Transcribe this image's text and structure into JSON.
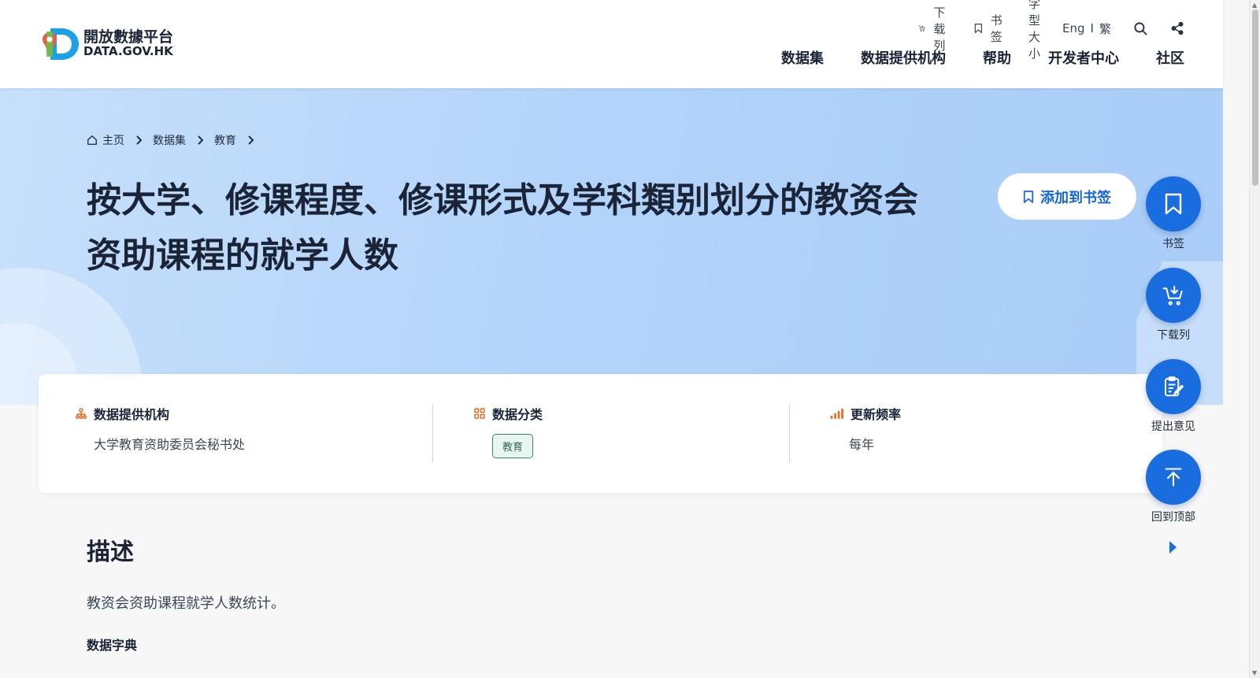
{
  "header": {
    "logo_zh": "開放數據平台",
    "logo_en": "DATA.GOV.HK",
    "util": {
      "download_list": "下载列",
      "bookmark": "书签",
      "font_size": "字型大小",
      "lang_en": "Eng",
      "lang_sep": "I",
      "lang_tc": "繁"
    },
    "nav": [
      "数据集",
      "数据提供机构",
      "帮助",
      "开发者中心",
      "社区"
    ]
  },
  "breadcrumb": [
    "主页",
    "数据集",
    "教育"
  ],
  "title": "按大学、修课程度、修课形式及学科類别划分的教资会资助课程的就学人数",
  "title_line1": "按大学、修课程度、修课形式及学科類别划分的教资会",
  "title_line2": "资助课程的就学人数",
  "add_bookmark_button": "添加到书签",
  "info": {
    "provider_label": "数据提供机构",
    "provider_value": "大学教育资助委员会秘书处",
    "category_label": "数据分类",
    "category_value": "教育",
    "frequency_label": "更新频率",
    "frequency_value": "每年"
  },
  "description": {
    "heading": "描述",
    "text": "教资会资助课程就学人数统计。",
    "dict_heading": "数据字典"
  },
  "side_actions": {
    "bookmark": "书签",
    "download_list": "下载列",
    "feedback": "提出意见",
    "back_to_top": "回到顶部"
  },
  "colors": {
    "primary": "#1a6ddf",
    "accent_orange": "#e8691e",
    "tag_green": "#2f8a63"
  }
}
